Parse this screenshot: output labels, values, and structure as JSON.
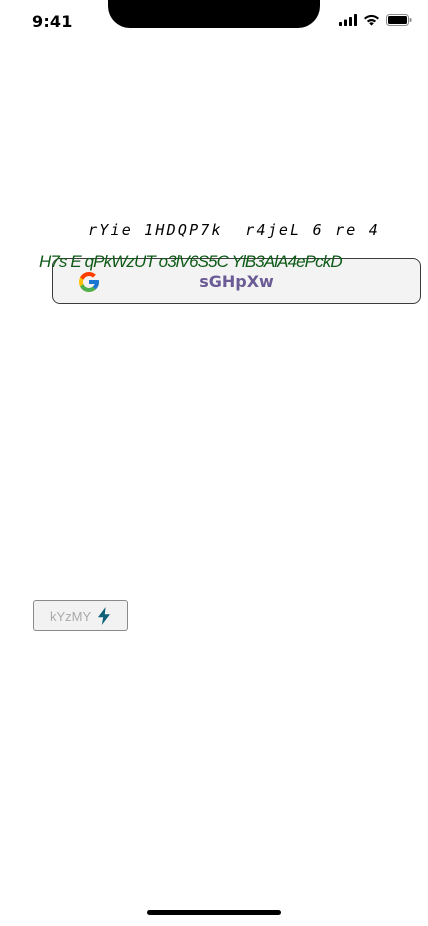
{
  "status_bar": {
    "time": "9:41",
    "icons": [
      "signal-icon",
      "wifi-icon",
      "battery-icon"
    ]
  },
  "mono_line": {
    "text": "rYie 1HDQP7k  r4jeL 6 re 4"
  },
  "green_line": {
    "text": "H7s E qPkWzUT o3lV6S5C YlB3AlA4ePckD",
    "color": "#0e5b17"
  },
  "google_button": {
    "label": "sGHpXw",
    "icon": "google-icon",
    "label_color": "#6b5b95"
  },
  "small_button": {
    "label": "kYzMY",
    "icon": "bolt-icon",
    "icon_color": "#0e5f78"
  }
}
